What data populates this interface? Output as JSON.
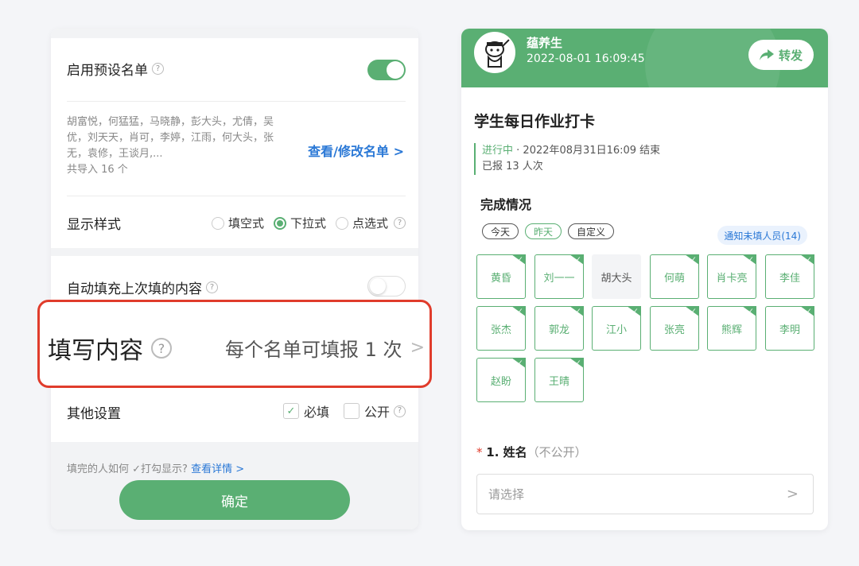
{
  "left": {
    "enable_preset": {
      "label": "启用预设名单",
      "toggle_on": true
    },
    "names": {
      "text": "胡富悦，何猛猛，马晓静，彭大头，尤倩，吴优，刘天天，肖可，李婷，江雨，何大头，张无，袁修，王谈月,...",
      "count_label": "共导入 16 个",
      "view_link": "查看/修改名单 >"
    },
    "display_style": {
      "label": "显示样式",
      "options": [
        "填空式",
        "下拉式",
        "点选式"
      ],
      "selected": "下拉式"
    },
    "autofill": {
      "label": "自动填充上次填的内容",
      "toggle_on": false
    },
    "fill_content": {
      "label": "填写内容",
      "value": "每个名单可填报 1 次"
    },
    "other_settings": {
      "label": "其他设置",
      "required_label": "必填",
      "required_checked": true,
      "public_label": "公开",
      "public_checked": false
    },
    "bottom_note": {
      "text": "填完的人如何 ✓打勾显示?",
      "link": "查看详情 >"
    },
    "confirm_button": "确定"
  },
  "right": {
    "user": {
      "name": "蕴养生",
      "time": "2022-08-01 16:09:45"
    },
    "share_button": "转发",
    "title": "学生每日作业打卡",
    "status": {
      "state": "进行中",
      "end": "· 2022年08月31日16:09 结束",
      "reported": "已报 13 人次"
    },
    "completion_title": "完成情况",
    "filters": [
      "今天",
      "昨天",
      "自定义"
    ],
    "selected_filter": "昨天",
    "notify_button": "通知未填人员(14)",
    "people": [
      {
        "name": "黄昏",
        "done": true
      },
      {
        "name": "刘一一",
        "done": true
      },
      {
        "name": "胡大头",
        "done": false
      },
      {
        "name": "何萌",
        "done": true
      },
      {
        "name": "肖卡亮",
        "done": true
      },
      {
        "name": "李佳",
        "done": true
      },
      {
        "name": "张杰",
        "done": true
      },
      {
        "name": "郭龙",
        "done": true
      },
      {
        "name": "江小",
        "done": true
      },
      {
        "name": "张亮",
        "done": true
      },
      {
        "name": "熊辉",
        "done": true
      },
      {
        "name": "李明",
        "done": true
      },
      {
        "name": "赵盼",
        "done": true
      },
      {
        "name": "王晴",
        "done": true
      }
    ],
    "question": {
      "required_mark": "*",
      "number_title": "1. 姓名",
      "note": "（不公开）",
      "placeholder": "请选择"
    }
  },
  "colors": {
    "accent_green": "#5aaf73",
    "link_blue": "#2a78d6",
    "highlight_red": "#e03c2c"
  }
}
